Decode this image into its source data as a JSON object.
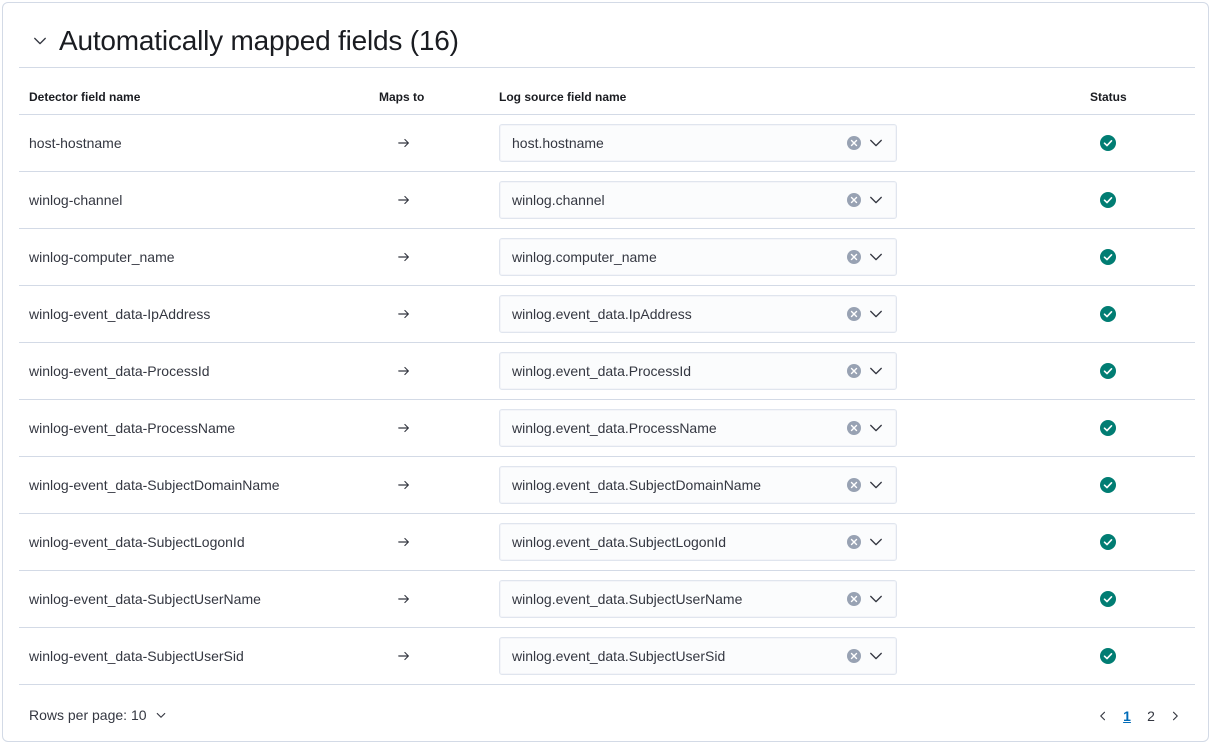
{
  "section": {
    "title": "Automatically mapped fields (16)"
  },
  "table": {
    "columns": {
      "detector": "Detector field name",
      "maps_to": "Maps to",
      "log_source": "Log source field name",
      "status": "Status"
    },
    "rows": [
      {
        "detector": "host-hostname",
        "log_source": "host.hostname",
        "status": "mapped"
      },
      {
        "detector": "winlog-channel",
        "log_source": "winlog.channel",
        "status": "mapped"
      },
      {
        "detector": "winlog-computer_name",
        "log_source": "winlog.computer_name",
        "status": "mapped"
      },
      {
        "detector": "winlog-event_data-IpAddress",
        "log_source": "winlog.event_data.IpAddress",
        "status": "mapped"
      },
      {
        "detector": "winlog-event_data-ProcessId",
        "log_source": "winlog.event_data.ProcessId",
        "status": "mapped"
      },
      {
        "detector": "winlog-event_data-ProcessName",
        "log_source": "winlog.event_data.ProcessName",
        "status": "mapped"
      },
      {
        "detector": "winlog-event_data-SubjectDomainName",
        "log_source": "winlog.event_data.SubjectDomainName",
        "status": "mapped"
      },
      {
        "detector": "winlog-event_data-SubjectLogonId",
        "log_source": "winlog.event_data.SubjectLogonId",
        "status": "mapped"
      },
      {
        "detector": "winlog-event_data-SubjectUserName",
        "log_source": "winlog.event_data.SubjectUserName",
        "status": "mapped"
      },
      {
        "detector": "winlog-event_data-SubjectUserSid",
        "log_source": "winlog.event_data.SubjectUserSid",
        "status": "mapped"
      }
    ]
  },
  "footer": {
    "rows_per_page": "Rows per page: 10",
    "pages": [
      "1",
      "2"
    ],
    "current_page": "1"
  },
  "icons": {
    "collapse": "chevron-down-icon",
    "maps_to": "arrow-right-icon",
    "clear": "clear-circle-icon",
    "dropdown": "chevron-down-icon",
    "status": "check-circle-icon",
    "prev": "chevron-left-icon",
    "next": "chevron-right-icon"
  },
  "colors": {
    "status_success": "#017d73",
    "link_active": "#006bb8",
    "border": "#d3dae6",
    "clear_icon": "#98a2b3"
  }
}
